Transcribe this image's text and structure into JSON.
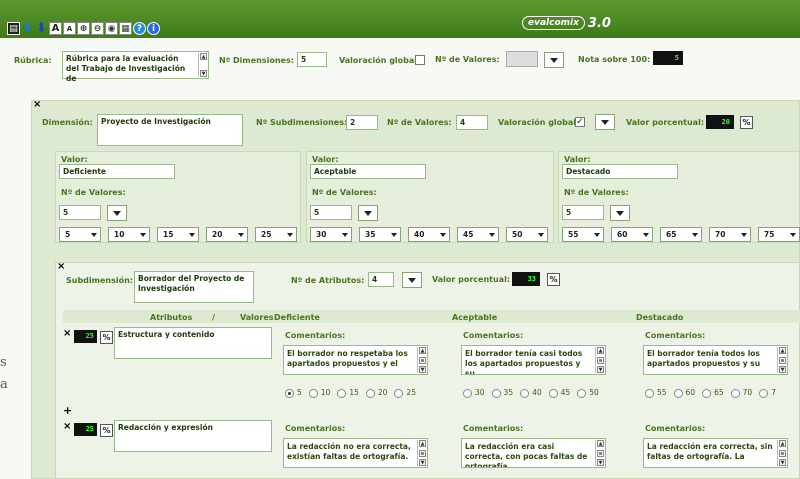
{
  "app": {
    "logo_name": "evalcomix",
    "version": "3.0"
  },
  "toolbar": {
    "icons": [
      "save-icon",
      "arrow-up-icon",
      "arrow-down-icon",
      "font-increase-icon",
      "font-decrease-icon",
      "zoom-in-icon",
      "zoom-out-icon",
      "preview-icon",
      "print-icon",
      "help-icon",
      "info-icon"
    ],
    "font_big": "A",
    "font_small": "A"
  },
  "rubric": {
    "label": "Rúbrica:",
    "title": "Rúbrica para la evaluación del Trabajo de Investigación de",
    "dims_label": "Nº Dimensiones:",
    "dims_value": "5",
    "global_label": "Valoración global",
    "values_label": "Nº de Valores:",
    "grade_label": "Nota sobre 100:",
    "grade_value": "5"
  },
  "dimension": {
    "close": "×",
    "label": "Dimensión:",
    "name": "Proyecto de Investigación",
    "subdims_label": "Nº Subdimensiones:",
    "subdims_value": "2",
    "values_label": "Nº de Valores:",
    "values_value": "4",
    "global_label": "Valoración global",
    "global_check": "✓",
    "percent_label": "Valor porcentual:",
    "percent_value": "20",
    "percent_btn": "%",
    "value_blocks": [
      {
        "label": "Valor:",
        "name": "Deficiente",
        "count_label": "Nº de Valores:",
        "count": "5",
        "options": [
          "5",
          "10",
          "15",
          "20",
          "25"
        ]
      },
      {
        "label": "Valor:",
        "name": "Aceptable",
        "count_label": "Nº de Valores:",
        "count": "5",
        "options": [
          "30",
          "35",
          "40",
          "45",
          "50"
        ]
      },
      {
        "label": "Valor:",
        "name": "Destacado",
        "count_label": "Nº de Valores:",
        "count": "5",
        "options": [
          "55",
          "60",
          "65",
          "70",
          "75"
        ]
      }
    ]
  },
  "subdimension": {
    "close": "×",
    "label": "Subdimensión:",
    "name": "Borrador del Proyecto de Investigación",
    "attrs_label": "Nº de Atributos:",
    "attrs_value": "4",
    "percent_label": "Valor porcentual:",
    "percent_value": "33",
    "percent_btn": "%",
    "head_attrs": "Atributos",
    "head_sep": "/",
    "head_vals": "Valores",
    "columns": [
      "Deficiente",
      "Aceptable",
      "Destacado"
    ],
    "add": "+",
    "attributes": [
      {
        "close": "×",
        "weight": "25",
        "pct": "%",
        "name": "Estructura y contenido",
        "comment_label": "Comentarios:",
        "comments": [
          "El borrador no respetaba los apartados propuestos y el",
          "El borrador tenía casi todos los apartados propuestos y su",
          "El borrador tenía todos los apartados propuestos y su"
        ],
        "radios": [
          [
            "5",
            "10",
            "15",
            "20",
            "25"
          ],
          [
            "30",
            "35",
            "40",
            "45",
            "50"
          ],
          [
            "55",
            "60",
            "65",
            "70",
            "7"
          ]
        ],
        "selected": "5"
      },
      {
        "close": "×",
        "weight": "25",
        "pct": "%",
        "name": "Redacción y expresión",
        "comment_label": "Comentarios:",
        "comments": [
          "La redacción no era correcta, existían faltas de ortografía.",
          "La redacción era casi correcta, con pocas faltas de ortografía.",
          "La redacción era correcta, sin faltas de ortografía. La"
        ]
      }
    ]
  },
  "left_edge": {
    "chars": [
      "s",
      "a"
    ]
  }
}
